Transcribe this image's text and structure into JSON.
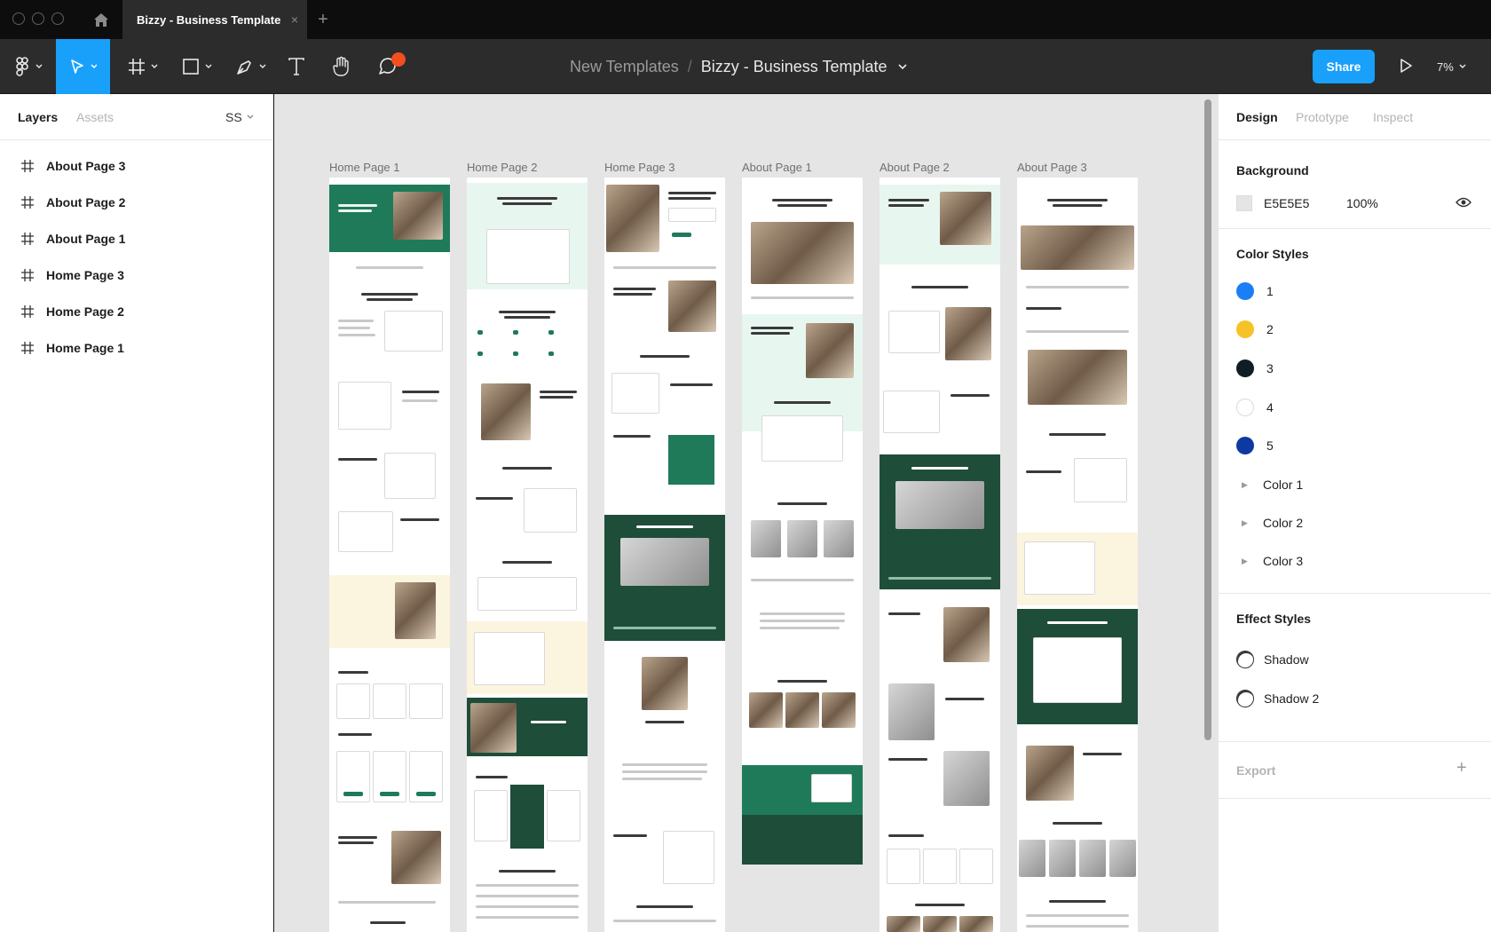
{
  "window": {
    "tab_title": "Bizzy - Business Template",
    "close_symbol": "×",
    "new_tab_symbol": "+"
  },
  "toolbar": {
    "breadcrumb_project": "New Templates",
    "breadcrumb_separator": "/",
    "breadcrumb_file": "Bizzy - Business Template",
    "share_label": "Share",
    "zoom_level": "7%",
    "active_tool": "move",
    "has_notification": true,
    "accent_color": "#18a0fb"
  },
  "left_panel": {
    "tabs": {
      "layers": "Layers",
      "assets": "Assets"
    },
    "page_selector": "SS",
    "layers": [
      {
        "name": "About Page 3",
        "icon": "frame-icon"
      },
      {
        "name": "About Page 2",
        "icon": "frame-icon"
      },
      {
        "name": "About Page 1",
        "icon": "frame-icon"
      },
      {
        "name": "Home Page 3",
        "icon": "frame-icon"
      },
      {
        "name": "Home Page 2",
        "icon": "frame-icon"
      },
      {
        "name": "Home Page 1",
        "icon": "frame-icon"
      }
    ]
  },
  "canvas": {
    "background": "#e5e5e5",
    "frames": [
      {
        "label": "Home Page 1"
      },
      {
        "label": "Home Page 2"
      },
      {
        "label": "Home Page 3"
      },
      {
        "label": "About Page 1"
      },
      {
        "label": "About Page 2"
      },
      {
        "label": "About Page 3"
      }
    ]
  },
  "right_panel": {
    "tabs": {
      "design": "Design",
      "prototype": "Prototype",
      "inspect": "Inspect"
    },
    "background": {
      "title": "Background",
      "hex": "E5E5E5",
      "opacity": "100%"
    },
    "color_styles": {
      "title": "Color Styles",
      "swatches": [
        {
          "name": "1",
          "color": "#1a7ff5"
        },
        {
          "name": "2",
          "color": "#f5c227"
        },
        {
          "name": "3",
          "color": "#0f1d24"
        },
        {
          "name": "4",
          "color": "#ffffff"
        },
        {
          "name": "5",
          "color": "#0d3aa0"
        }
      ],
      "groups": [
        "Color 1",
        "Color 2",
        "Color 3"
      ]
    },
    "effect_styles": {
      "title": "Effect Styles",
      "items": [
        "Shadow",
        "Shadow 2"
      ]
    },
    "export": {
      "title": "Export",
      "add_symbol": "+"
    }
  }
}
